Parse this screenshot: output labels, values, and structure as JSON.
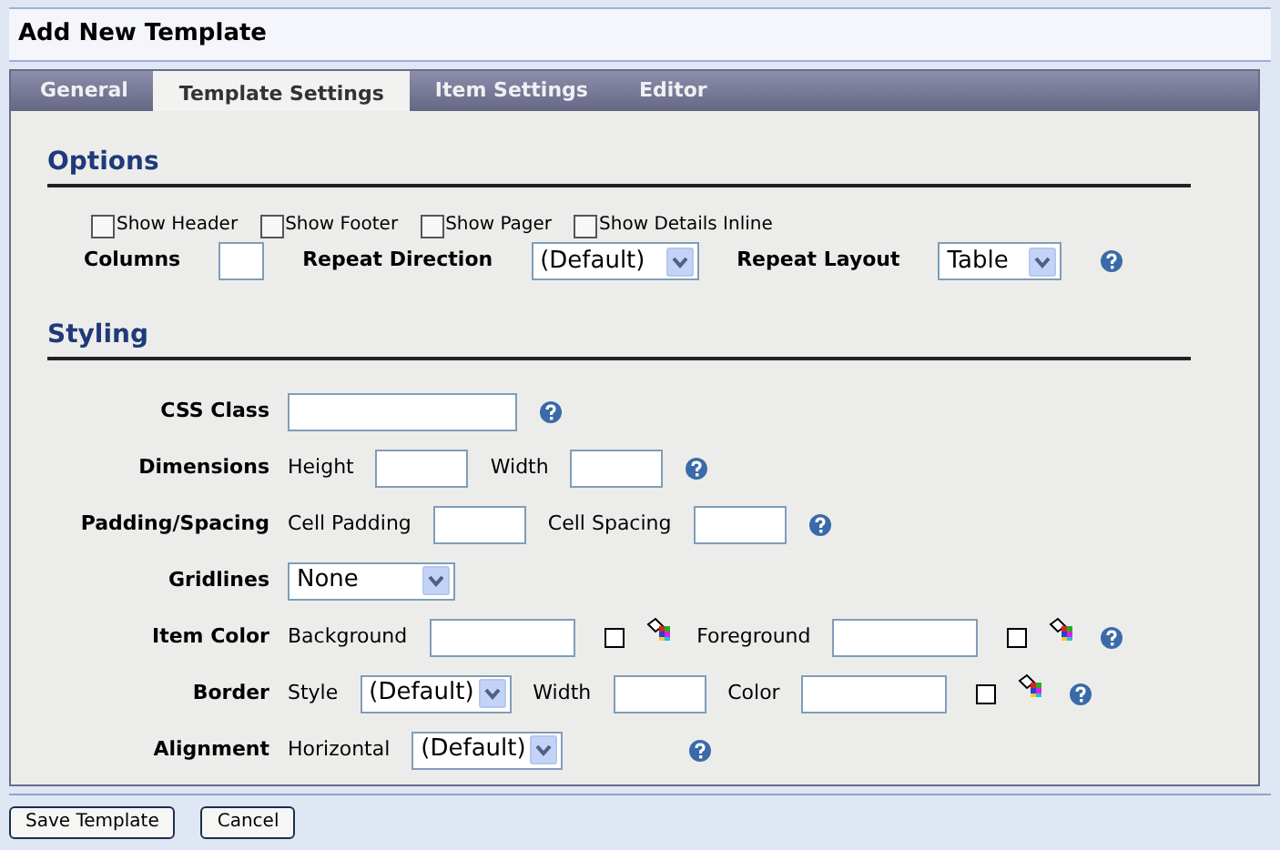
{
  "title": "Add New Template",
  "tabs": [
    {
      "label": "General",
      "selected": false
    },
    {
      "label": "Template Settings",
      "selected": true
    },
    {
      "label": "Item Settings",
      "selected": false
    },
    {
      "label": "Editor",
      "selected": false
    }
  ],
  "options": {
    "heading": "Options",
    "checkboxes": [
      {
        "label": "Show Header",
        "checked": false
      },
      {
        "label": "Show Footer",
        "checked": false
      },
      {
        "label": "Show Pager",
        "checked": false
      },
      {
        "label": "Show Details Inline",
        "checked": false
      }
    ],
    "row": [
      {
        "kind": "label",
        "text": "Columns"
      },
      {
        "kind": "tiny_input"
      },
      {
        "kind": "label",
        "text": "Repeat Direction"
      },
      {
        "kind": "wide_select",
        "value": "(Default)"
      },
      {
        "kind": "label",
        "text": "Repeat Layout"
      },
      {
        "kind": "short_select",
        "value": "Table"
      },
      {
        "kind": "help"
      }
    ]
  },
  "styling": {
    "heading": "Styling",
    "rows": [
      {
        "label": "CSS Class",
        "items": [
          {
            "kind": "wide_input"
          },
          {
            "kind": "help"
          }
        ]
      },
      {
        "label": "Dimensions",
        "items": [
          {
            "kind": "text",
            "text": "Height"
          },
          {
            "kind": "input"
          },
          {
            "kind": "text",
            "text": "Width"
          },
          {
            "kind": "input"
          },
          {
            "kind": "help"
          }
        ]
      },
      {
        "label": "Padding/Spacing",
        "items": [
          {
            "kind": "text",
            "text": "Cell Padding"
          },
          {
            "kind": "input"
          },
          {
            "kind": "text",
            "text": "Cell Spacing"
          },
          {
            "kind": "input"
          },
          {
            "kind": "help"
          }
        ]
      },
      {
        "label": "Gridlines",
        "items": [
          {
            "kind": "wide_select",
            "value": "None"
          }
        ]
      },
      {
        "label": "Item Color",
        "items": [
          {
            "kind": "text",
            "text": "Background"
          },
          {
            "kind": "color_input"
          },
          {
            "kind": "swatch"
          },
          {
            "kind": "picker"
          },
          {
            "kind": "text",
            "text": "Foreground"
          },
          {
            "kind": "color_input"
          },
          {
            "kind": "swatch"
          },
          {
            "kind": "picker"
          },
          {
            "kind": "help"
          }
        ]
      },
      {
        "label": "Border",
        "items": [
          {
            "kind": "text",
            "text": "Style"
          },
          {
            "kind": "select",
            "value": "(Default)"
          },
          {
            "kind": "text",
            "text": "Width"
          },
          {
            "kind": "input"
          },
          {
            "kind": "text",
            "text": "Color"
          },
          {
            "kind": "color_input"
          },
          {
            "kind": "swatch"
          },
          {
            "kind": "picker"
          },
          {
            "kind": "help"
          }
        ]
      },
      {
        "label": "Alignment",
        "items": [
          {
            "kind": "text",
            "text": "Horizontal"
          },
          {
            "kind": "select",
            "value": "(Default)"
          },
          {
            "kind": "spacer"
          },
          {
            "kind": "help"
          }
        ]
      }
    ]
  },
  "buttons": [
    "Save Template",
    "Cancel"
  ]
}
